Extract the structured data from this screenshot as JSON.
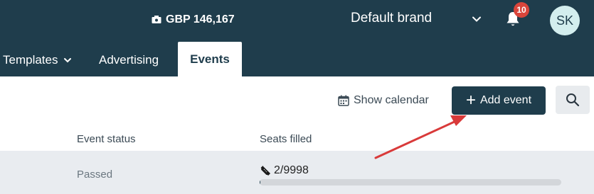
{
  "header": {
    "balance": "GBP 146,167",
    "brand": "Default brand",
    "notification_count": "10",
    "avatar_initials": "SK"
  },
  "tabs": [
    {
      "label": "Templates"
    },
    {
      "label": "Advertising"
    },
    {
      "label": "Events"
    }
  ],
  "toolbar": {
    "show_calendar": "Show calendar",
    "add_event": "Add event"
  },
  "table": {
    "headers": [
      "Event status",
      "Seats filled"
    ],
    "rows": [
      {
        "status": "Passed",
        "seats": "2/9998",
        "seats_filled_fraction": 0.0002
      }
    ]
  },
  "colors": {
    "header_bg": "#1f3d4c",
    "badge": "#d9453b",
    "annotation_arrow": "#d93a3a"
  }
}
